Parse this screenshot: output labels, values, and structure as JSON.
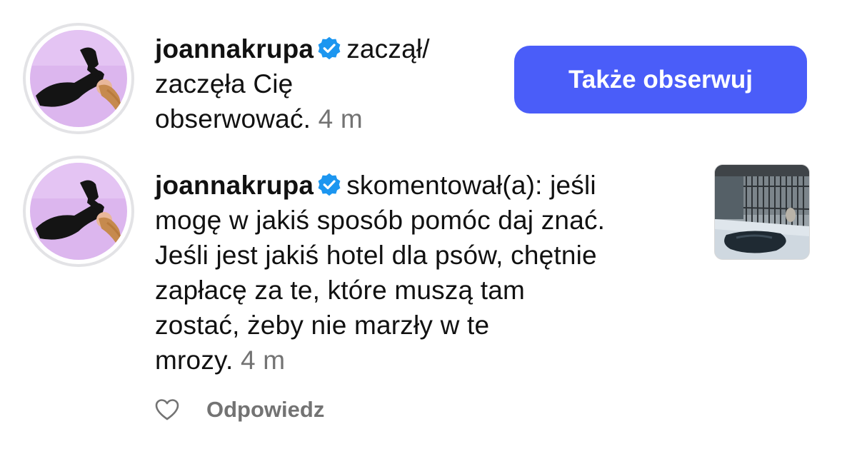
{
  "notifications": [
    {
      "username": "joannakrupa",
      "verified": true,
      "text_line1": "zaczął/",
      "text_line2": "zaczęła Cię",
      "text_line3": "obserwować.",
      "time": "4 m",
      "action_label": "Także obserwuj"
    },
    {
      "username": "joannakrupa",
      "verified": true,
      "text_line1": "skomentował(a): jeśli",
      "text_line2": "mogę w jakiś sposób pomóc daj znać.",
      "text_line3": "Jeśli jest jakiś hotel dla psów, chętnie",
      "text_line4": "zapłacę za te, które muszą tam",
      "text_line5": "zostać, żeby nie marzły w te",
      "text_line6": "mrozy.",
      "time": "4 m",
      "reply_label": "Odpowiedz"
    }
  ],
  "icons": {
    "verified": "verified-badge-icon",
    "like": "heart-icon"
  },
  "colors": {
    "accent": "#4a5df9",
    "verified": "#1c96f0",
    "muted": "#737373",
    "avatar_bg": "#dcb6ee"
  }
}
